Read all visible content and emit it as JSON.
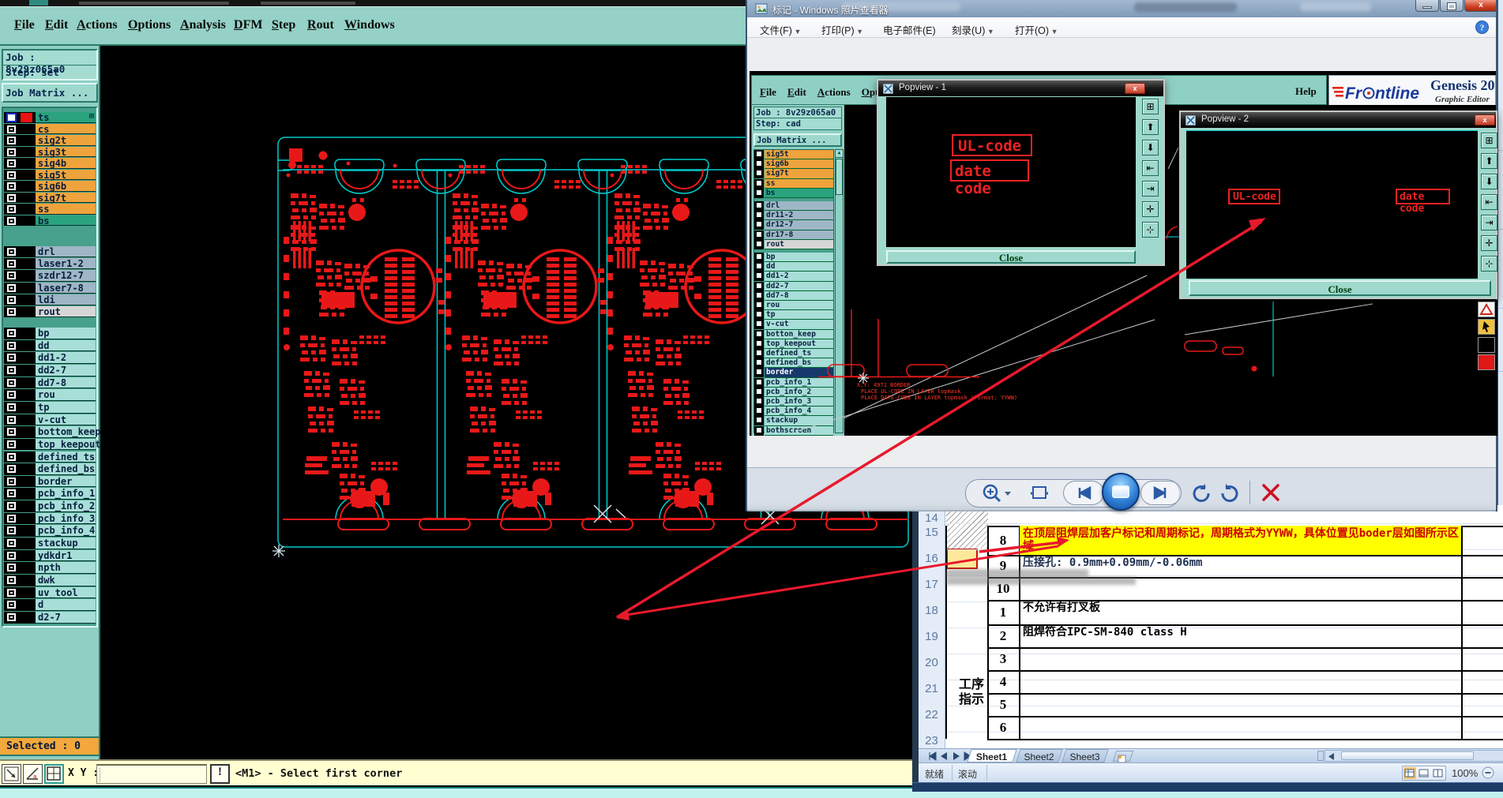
{
  "main_app": {
    "menus": [
      "File",
      "Edit",
      "Actions",
      "Options",
      "Analysis",
      "DFM",
      "Step",
      "Rout",
      "Windows"
    ],
    "job_label": "Job : 8v29z065a0",
    "step_label": "Step: set",
    "job_matrix_label": "Job Matrix ...",
    "layer_groups": [
      {
        "rows": [
          {
            "name": "ts",
            "tone": "green",
            "selected": true,
            "swatch": "#ee1111"
          },
          {
            "name": "cs",
            "tone": "orange"
          },
          {
            "name": "sig2t",
            "tone": "orange"
          },
          {
            "name": "sig3t",
            "tone": "orange"
          },
          {
            "name": "sig4b",
            "tone": "orange"
          },
          {
            "name": "sig5t",
            "tone": "orange"
          },
          {
            "name": "sig6b",
            "tone": "orange"
          },
          {
            "name": "sig7t",
            "tone": "orange"
          },
          {
            "name": "ss",
            "tone": "orange"
          },
          {
            "name": "bs",
            "tone": "green"
          }
        ]
      },
      {
        "rows": [
          {
            "name": "drl",
            "tone": "gray"
          },
          {
            "name": "laser1-2",
            "tone": "gray"
          },
          {
            "name": "szdr12-7",
            "tone": "gray"
          },
          {
            "name": "laser7-8",
            "tone": "gray"
          },
          {
            "name": "ldi",
            "tone": "gray"
          },
          {
            "name": "rout",
            "tone": "lite"
          }
        ]
      },
      {
        "rows": [
          {
            "name": "bp",
            "tone": "teal"
          },
          {
            "name": "dd",
            "tone": "teal"
          },
          {
            "name": "dd1-2",
            "tone": "teal"
          },
          {
            "name": "dd2-7",
            "tone": "teal"
          },
          {
            "name": "dd7-8",
            "tone": "teal"
          },
          {
            "name": "rou",
            "tone": "teal"
          },
          {
            "name": "tp",
            "tone": "teal"
          },
          {
            "name": "v-cut",
            "tone": "teal"
          },
          {
            "name": "bottom_keep",
            "tone": "teal"
          },
          {
            "name": "top_keepout",
            "tone": "teal"
          },
          {
            "name": "defined_ts",
            "tone": "teal"
          },
          {
            "name": "defined_bs",
            "tone": "teal"
          },
          {
            "name": "border",
            "tone": "teal"
          },
          {
            "name": "pcb_info_1",
            "tone": "teal"
          },
          {
            "name": "pcb_info_2",
            "tone": "teal"
          },
          {
            "name": "pcb_info_3",
            "tone": "teal"
          },
          {
            "name": "pcb_info_4",
            "tone": "teal"
          },
          {
            "name": "stackup",
            "tone": "teal"
          },
          {
            "name": "ydkdr1",
            "tone": "teal"
          },
          {
            "name": "npth",
            "tone": "teal"
          },
          {
            "name": "dwk",
            "tone": "teal"
          },
          {
            "name": "uv_tool",
            "tone": "teal"
          },
          {
            "name": "d",
            "tone": "teal"
          },
          {
            "name": "d2-7",
            "tone": "teal"
          }
        ]
      }
    ],
    "selected_label": "Selected : 0",
    "status": {
      "xy_label": "X Y :",
      "input_value": "",
      "message": "<M1> - Select first corner"
    }
  },
  "photo_viewer": {
    "title": "标记 - Windows 照片查看器",
    "menu": [
      {
        "label": "文件(F)",
        "dd": true
      },
      {
        "label": "打印(P)",
        "dd": true
      },
      {
        "label": "电子邮件(E)",
        "dd": false
      },
      {
        "label": "刻录(U)",
        "dd": true
      },
      {
        "label": "打开(O)",
        "dd": true
      }
    ]
  },
  "photo": {
    "menus": [
      "File",
      "Edit",
      "Actions",
      "Options"
    ],
    "help_label": "Help",
    "brand": {
      "name": "Frontline",
      "product": "Genesis 20",
      "edition": "Graphic Editor"
    },
    "job_label": "Job : 8v29z065a0",
    "step_label": "Step: cad",
    "job_matrix_label": "Job Matrix ...",
    "layer_groups": [
      {
        "rows": [
          {
            "name": "sig5t",
            "tone": "orange"
          },
          {
            "name": "sig6b",
            "tone": "orange"
          },
          {
            "name": "sig7t",
            "tone": "orange"
          },
          {
            "name": "ss",
            "tone": "orange"
          },
          {
            "name": "bs",
            "tone": "green"
          }
        ]
      },
      {
        "rows": [
          {
            "name": "drl",
            "tone": "gray"
          },
          {
            "name": "dr11-2",
            "tone": "gray"
          },
          {
            "name": "dr12-7",
            "tone": "gray"
          },
          {
            "name": "dr17-8",
            "tone": "gray"
          },
          {
            "name": "rout",
            "tone": "lite"
          }
        ]
      },
      {
        "rows": [
          {
            "name": "bp",
            "tone": "teal"
          },
          {
            "name": "dd",
            "tone": "teal"
          },
          {
            "name": "dd1-2",
            "tone": "teal"
          },
          {
            "name": "dd2-7",
            "tone": "teal"
          },
          {
            "name": "dd7-8",
            "tone": "teal"
          },
          {
            "name": "rou",
            "tone": "teal"
          },
          {
            "name": "tp",
            "tone": "teal"
          },
          {
            "name": "v-cut",
            "tone": "teal"
          },
          {
            "name": "botton_keep",
            "tone": "teal"
          },
          {
            "name": "top_keepout",
            "tone": "teal"
          },
          {
            "name": "defined_ts",
            "tone": "teal"
          },
          {
            "name": "defined_bs",
            "tone": "teal"
          },
          {
            "name": "border",
            "tone": "sel"
          },
          {
            "name": "pcb_info_1",
            "tone": "teal"
          },
          {
            "name": "pcb_info_2",
            "tone": "teal"
          },
          {
            "name": "pcb_info_3",
            "tone": "teal"
          },
          {
            "name": "pcb_info_4",
            "tone": "teal"
          },
          {
            "name": "stackup",
            "tone": "teal"
          },
          {
            "name": "bothscreen",
            "tone": "teal"
          }
        ]
      }
    ],
    "popview1": {
      "title": "Popview - 1",
      "label1": "UL-code",
      "label2": "date code",
      "close": "Close"
    },
    "popview2": {
      "title": "Popview - 2",
      "label1": "UL-code",
      "label2": "date code",
      "close": "Close"
    },
    "canvas_status": [
      "X,Y: 4971  BORDER",
      "PLACE UL-CODE IN LAYER topmask",
      "PLACE DATE-CODE IN LAYER topmask (Format: YYWW)"
    ]
  },
  "excel": {
    "row_headers": [
      "14",
      "15",
      "16",
      "17",
      "18",
      "19",
      "20",
      "21",
      "22",
      "23"
    ],
    "rows": [
      {
        "no": "8",
        "text": "在顶层阻焊层加客户标记和周期标记，周期格式为YYWW，具体位置见boder层如图所示区",
        "text2": "域",
        "highlight": true
      },
      {
        "no": "9",
        "text": "压接孔: 0.9mm+0.09mm/-0.06mm",
        "highlight": false
      },
      {
        "no": "10",
        "text": "",
        "highlight": false
      },
      {
        "no": "1",
        "text": "不允许有打叉板",
        "highlight": false
      },
      {
        "no": "2",
        "text": "阻焊符合IPC-SM-840 class H",
        "highlight": false
      },
      {
        "no": "3",
        "text": "",
        "highlight": false
      },
      {
        "no": "4",
        "text": "",
        "highlight": false
      },
      {
        "no": "5",
        "text": "",
        "highlight": false
      },
      {
        "no": "6",
        "text": "",
        "highlight": false
      }
    ],
    "group_label_line1": "工序",
    "group_label_line2": "指示",
    "sheets": [
      "Sheet1",
      "Sheet2",
      "Sheet3"
    ],
    "status": {
      "ready": "就绪",
      "scroll": "滚动",
      "zoom": "100%"
    }
  }
}
